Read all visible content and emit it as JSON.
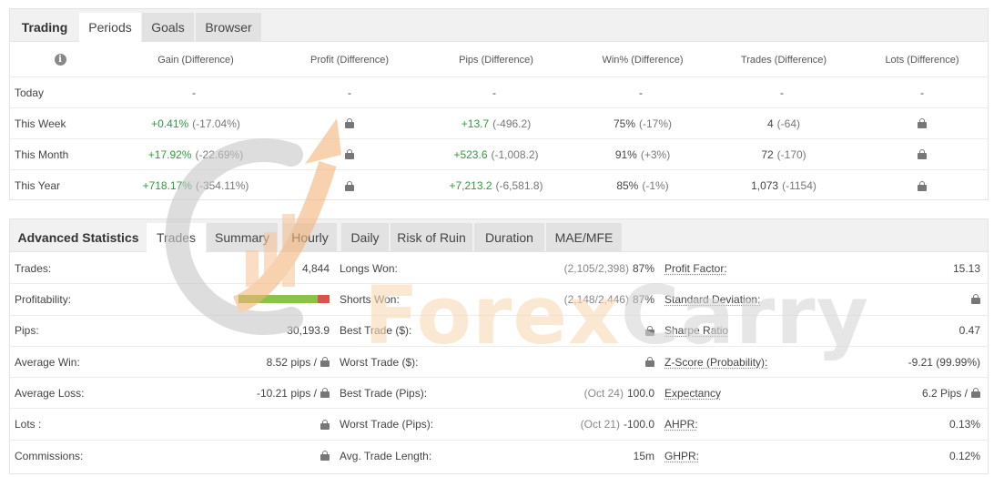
{
  "top_tabs": [
    "Trading",
    "Periods",
    "Goals",
    "Browser"
  ],
  "periods": {
    "headers": [
      "Gain (Difference)",
      "Profit (Difference)",
      "Pips (Difference)",
      "Win% (Difference)",
      "Trades (Difference)",
      "Lots (Difference)"
    ],
    "rows": [
      {
        "label": "Today",
        "gain_main": "-",
        "gain_diff": "",
        "profit": "-",
        "pips_main": "-",
        "pips_diff": "",
        "win_main": "-",
        "win_diff": "",
        "trades_main": "-",
        "trades_diff": "",
        "lots": "-"
      },
      {
        "label": "This Week",
        "gain_main": "+0.41%",
        "gain_diff": "(-17.04%)",
        "profit": "lock",
        "pips_main": "+13.7",
        "pips_diff": "(-496.2)",
        "win_main": "75%",
        "win_diff": "(-17%)",
        "trades_main": "4",
        "trades_diff": "(-64)",
        "lots": "lock"
      },
      {
        "label": "This Month",
        "gain_main": "+17.92%",
        "gain_diff": "(-22.69%)",
        "profit": "lock",
        "pips_main": "+523.6",
        "pips_diff": "(-1,008.2)",
        "win_main": "91%",
        "win_diff": "(+3%)",
        "trades_main": "72",
        "trades_diff": "(-170)",
        "lots": "lock"
      },
      {
        "label": "This Year",
        "gain_main": "+718.17%",
        "gain_diff": "(-354.11%)",
        "profit": "lock",
        "pips_main": "+7,213.2",
        "pips_diff": "(-6,581.8)",
        "win_main": "85%",
        "win_diff": "(-1%)",
        "trades_main": "1,073",
        "trades_diff": "(-1154)",
        "lots": "lock"
      }
    ]
  },
  "stats_tabs": [
    "Advanced Statistics",
    "Trades",
    "Summary",
    "Hourly",
    "Daily",
    "Risk of Ruin",
    "Duration",
    "MAE/MFE"
  ],
  "stats": {
    "rows": [
      {
        "l1": "Trades:",
        "v1": "4,844",
        "l2": "Longs Won:",
        "m2": "(2,105/2,398)",
        "v2": "87%",
        "l3": "Profit Factor:",
        "v3": "15.13"
      },
      {
        "l1": "Profitability:",
        "v1": "",
        "l2": "Shorts Won:",
        "m2": "(2,148/2,446)",
        "v2": "87%",
        "l3": "Standard Deviation:",
        "v3": ""
      },
      {
        "l1": "Pips:",
        "v1": "30,193.9",
        "l2": "Best Trade ($):",
        "m2": "",
        "v2": "",
        "l3": "Sharpe Ratio",
        "v3": "0.47"
      },
      {
        "l1": "Average Win:",
        "v1": "8.52 pips /",
        "l2": "Worst Trade ($):",
        "m2": "",
        "v2": "",
        "l3": "Z-Score (Probability):",
        "v3": "-9.21 (99.99%)"
      },
      {
        "l1": "Average Loss:",
        "v1": "-10.21 pips /",
        "l2": "Best Trade (Pips):",
        "m2": "(Oct 24)",
        "v2": "100.0",
        "l3": "Expectancy",
        "v3": "6.2 Pips /"
      },
      {
        "l1": "Lots :",
        "v1": "",
        "l2": "Worst Trade (Pips):",
        "m2": "(Oct 21)",
        "v2": "-100.0",
        "l3": "AHPR:",
        "v3": "0.13%"
      },
      {
        "l1": "Commissions:",
        "v1": "",
        "l2": "Avg. Trade Length:",
        "m2": "",
        "v2": "15m",
        "l3": "GHPR:",
        "v3": "0.12%"
      }
    ],
    "profitability_win_fraction": 0.87
  },
  "watermark": {
    "part1": "Forex",
    "part2": "Carry"
  },
  "colors": {
    "positive": "#2e9a3c",
    "bar_green": "#8bc34a",
    "bar_red": "#d9534f",
    "watermark_orange": "#f5a25d",
    "watermark_gray": "#bdbdbd"
  },
  "icons": [
    "info-icon",
    "lock-icon"
  ]
}
